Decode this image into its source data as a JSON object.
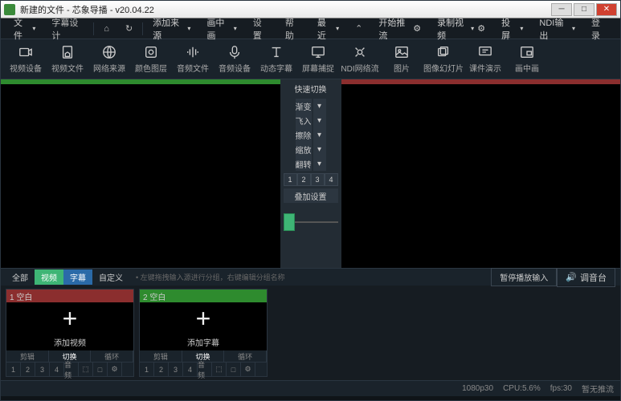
{
  "window": {
    "title": "新建的文件 - 芯象导播 - v20.04.22"
  },
  "menu": {
    "file": "文件",
    "subtitle": "字幕设计",
    "home": "⌂",
    "refresh": "↻",
    "add_source": "添加来源",
    "pip": "画中画",
    "settings": "设置",
    "help": "帮助",
    "recent": "最近",
    "start_stream": "开始推流",
    "record": "录制视频",
    "cast": "投屏",
    "ndi": "NDI输出",
    "login": "登录"
  },
  "toolbar": [
    {
      "icon": "camera",
      "label": "视频设备"
    },
    {
      "icon": "file",
      "label": "视频文件"
    },
    {
      "icon": "globe",
      "label": "网络来源"
    },
    {
      "icon": "color",
      "label": "颜色图层"
    },
    {
      "icon": "audio",
      "label": "音频文件"
    },
    {
      "icon": "mic",
      "label": "音频设备"
    },
    {
      "icon": "text",
      "label": "动态字幕"
    },
    {
      "icon": "screen",
      "label": "屏幕捕捉"
    },
    {
      "icon": "ndi",
      "label": "NDI网络流"
    },
    {
      "icon": "image",
      "label": "图片"
    },
    {
      "icon": "slides",
      "label": "图像幻灯片"
    },
    {
      "icon": "ppt",
      "label": "课件演示"
    },
    {
      "icon": "pip",
      "label": "画中画"
    }
  ],
  "transitions": {
    "title": "快速切换",
    "items": [
      "渐变",
      "飞入",
      "擦除",
      "缩放",
      "翻转"
    ],
    "nums": [
      "1",
      "2",
      "3",
      "4"
    ],
    "overlay": "叠加设置"
  },
  "tabs": {
    "all": "全部",
    "video": "视频",
    "subtitle": "字幕",
    "custom": "自定义",
    "hint": "• 左键拖拽输入源进行分组，右键编辑分组名称",
    "pause": "暂停播放输入",
    "mixer": "调音台"
  },
  "sources": [
    {
      "title": "1 空白",
      "add": "添加视频",
      "ctrls": [
        "剪辑",
        "切换",
        "循环"
      ]
    },
    {
      "title": "2 空白",
      "add": "添加字幕",
      "ctrls": [
        "剪辑",
        "切换",
        "循环"
      ]
    }
  ],
  "srcbtm": [
    "1",
    "2",
    "3",
    "4",
    "音频",
    "⬚",
    "□",
    "⚙"
  ],
  "status": {
    "res": "1080p30",
    "cpu": "CPU:5.6%",
    "fps": "fps:30",
    "stream": "暂无推流"
  }
}
